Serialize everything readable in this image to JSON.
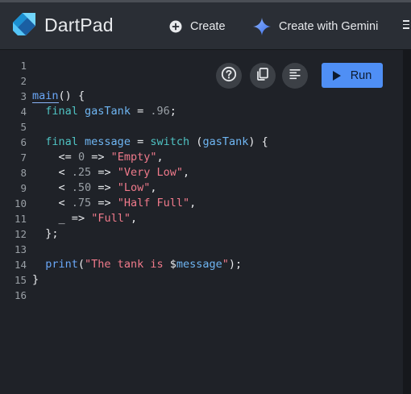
{
  "header": {
    "app_title": "DartPad",
    "create_label": "Create",
    "gemini_label": "Create with Gemini"
  },
  "toolbar": {
    "run_label": "Run"
  },
  "editor": {
    "line_numbers": [
      "1",
      "2",
      "3",
      "4",
      "5",
      "6",
      "7",
      "8",
      "9",
      "10",
      "11",
      "12",
      "13",
      "14",
      "15",
      "16"
    ],
    "code_lines": [
      "",
      "",
      "main() {",
      "  final gasTank = .96;",
      "",
      "  final message = switch (gasTank) {",
      "    <= 0 => \"Empty\",",
      "    < .25 => \"Very Low\",",
      "    < .50 => \"Low\",",
      "    < .75 => \"Half Full\",",
      "    _ => \"Full\",",
      "  };",
      "",
      "  print(\"The tank is $message\");",
      "}",
      ""
    ]
  },
  "colors": {
    "accent": "#4f8ff5",
    "keyword": "#4fc3c3",
    "string": "#f07a8b",
    "background": "#1f2228"
  }
}
